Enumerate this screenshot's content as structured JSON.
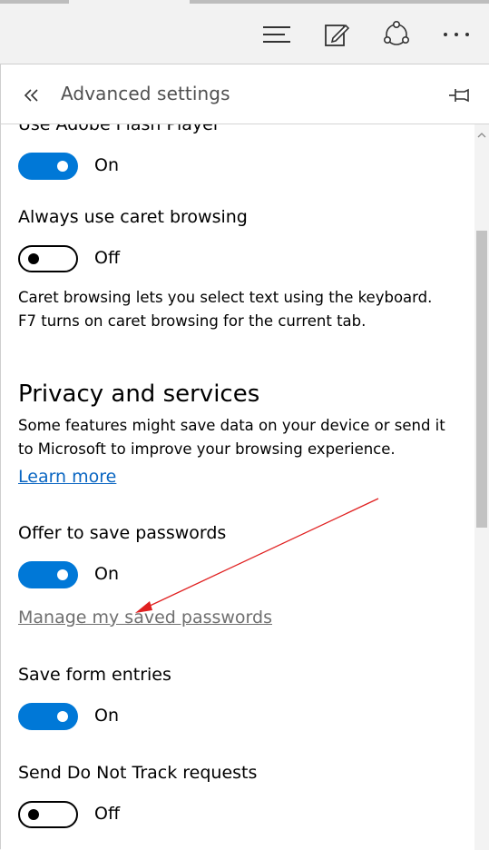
{
  "toolbar": {
    "hub_icon": "hub-icon",
    "note_icon": "web-note-icon",
    "share_icon": "share-icon",
    "more_icon": "more-icon"
  },
  "pane": {
    "title": "Advanced settings",
    "back_icon": "double-chevron-left-icon",
    "pin_icon": "pin-icon"
  },
  "settings": {
    "flash": {
      "label": "Use Adobe Flash Player",
      "state": "On"
    },
    "caret": {
      "label": "Always use caret browsing",
      "state": "Off",
      "desc_line1": "Caret browsing lets you select text using the keyboard.",
      "desc_line2": "F7 turns on caret browsing for the current tab."
    },
    "privacy": {
      "heading": "Privacy and services",
      "desc_line1": "Some features might save data on your device or send it",
      "desc_line2": "to Microsoft to improve your browsing experience.",
      "learn_more": "Learn more"
    },
    "passwords": {
      "label": "Offer to save passwords",
      "state": "On",
      "manage_link": "Manage my saved passwords"
    },
    "forms": {
      "label": "Save form entries",
      "state": "On"
    },
    "dnt": {
      "label": "Send Do Not Track requests",
      "state": "Off"
    }
  },
  "colors": {
    "accent": "#0078d7",
    "link": "#0a66c2",
    "annotation_arrow": "#e02020"
  }
}
